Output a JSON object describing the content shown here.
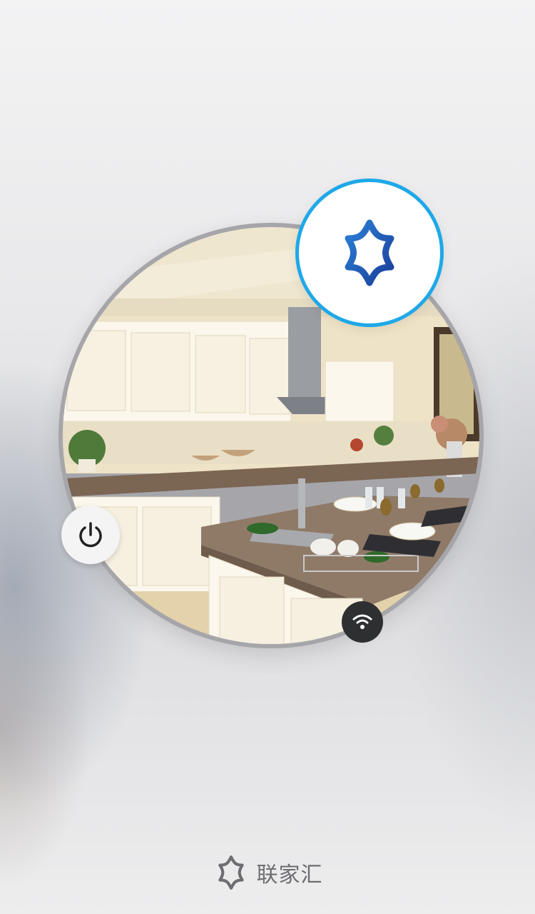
{
  "app": {
    "brand_name": "联家汇",
    "accent_color": "#1ea8e8",
    "logo_color": "#1f4fae"
  },
  "icons": {
    "logo": "six-point-star-logo-icon",
    "power": "power-icon",
    "wifi": "wifi-icon",
    "brand": "six-point-star-outline-icon"
  },
  "scene": {
    "subject": "kitchen-photo"
  }
}
